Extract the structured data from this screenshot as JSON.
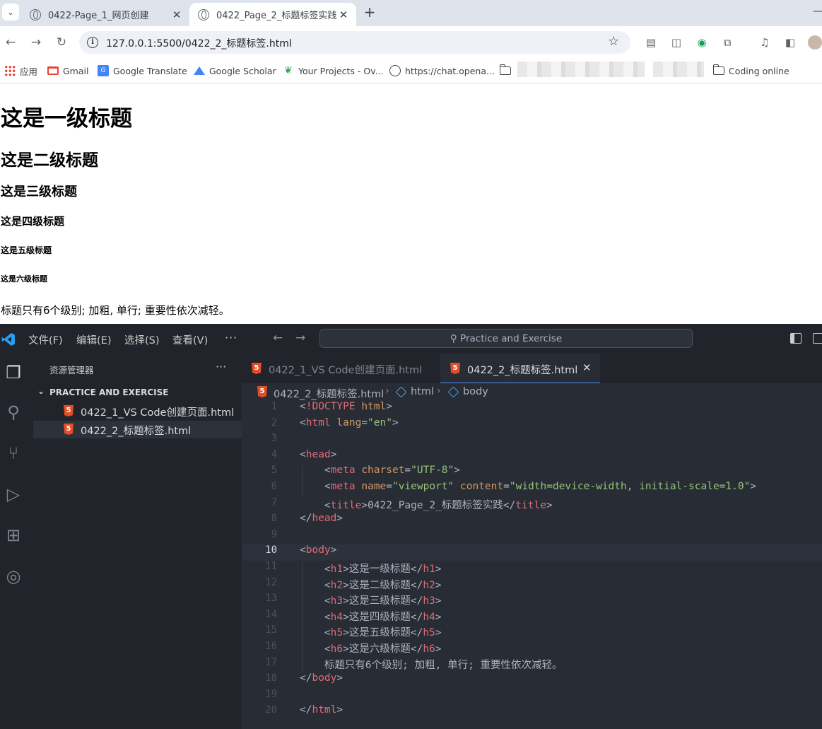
{
  "browser": {
    "tabs": [
      {
        "title": "0422-Page_1_网页创建",
        "active": false
      },
      {
        "title": "0422_Page_2_标题标签实践",
        "active": true
      }
    ],
    "new_tab_label": "+",
    "url": "127.0.0.1:5500/0422_2_标题标签.html",
    "bookmarks": [
      {
        "label": "应用",
        "icon": "apps-icon"
      },
      {
        "label": "Gmail",
        "icon": "gmail-icon"
      },
      {
        "label": "Google Translate",
        "icon": "google-translate-icon"
      },
      {
        "label": "Google Scholar",
        "icon": "google-scholar-icon"
      },
      {
        "label": "Your Projects - Ov...",
        "icon": "overleaf-icon"
      },
      {
        "label": "https://chat.opena...",
        "icon": "openai-icon"
      },
      {
        "label": "Coding online",
        "icon": "folder-icon"
      }
    ]
  },
  "page": {
    "h1": "这是一级标题",
    "h2": "这是二级标题",
    "h3": "这是三级标题",
    "h4": "这是四级标题",
    "h5": "这是五级标题",
    "h6": "这是六级标题",
    "paragraph": "标题只有6个级别; 加粗, 单行; 重要性依次减轻。"
  },
  "vscode": {
    "menu": [
      "文件(F)",
      "编辑(E)",
      "选择(S)",
      "查看(V)"
    ],
    "more": "···",
    "command_center": "Practice and Exercise",
    "explorer": {
      "title": "资源管理器",
      "more": "···",
      "folder": "PRACTICE AND EXERCISE",
      "files": [
        "0422_1_VS Code创建页面.html",
        "0422_2_标题标签.html"
      ]
    },
    "tabs": [
      {
        "label": "0422_1_VS Code创建页面.html",
        "active": false
      },
      {
        "label": "0422_2_标题标签.html",
        "active": true
      }
    ],
    "breadcrumb": [
      "0422_2_标题标签.html",
      "html",
      "body"
    ],
    "current_line": 10,
    "code": [
      {
        "n": "1",
        "t": [
          [
            "p",
            "<"
          ],
          [
            "t",
            "!DOCTYPE"
          ],
          [
            "p",
            " "
          ],
          [
            "a",
            "html"
          ],
          [
            "p",
            ">"
          ]
        ]
      },
      {
        "n": "2",
        "t": [
          [
            "p",
            "<"
          ],
          [
            "t",
            "html"
          ],
          [
            "p",
            " "
          ],
          [
            "a",
            "lang"
          ],
          [
            "p",
            "="
          ],
          [
            "s",
            "\"en\""
          ],
          [
            "p",
            ">"
          ]
        ]
      },
      {
        "n": "3",
        "t": []
      },
      {
        "n": "4",
        "t": [
          [
            "p",
            "<"
          ],
          [
            "t",
            "head"
          ],
          [
            "p",
            ">"
          ]
        ]
      },
      {
        "n": "5",
        "t": [
          [
            "p",
            "    <"
          ],
          [
            "t",
            "meta"
          ],
          [
            "p",
            " "
          ],
          [
            "a",
            "charset"
          ],
          [
            "p",
            "="
          ],
          [
            "s",
            "\"UTF-8\""
          ],
          [
            "p",
            ">"
          ]
        ]
      },
      {
        "n": "6",
        "t": [
          [
            "p",
            "    <"
          ],
          [
            "t",
            "meta"
          ],
          [
            "p",
            " "
          ],
          [
            "a",
            "name"
          ],
          [
            "p",
            "="
          ],
          [
            "s",
            "\"viewport\""
          ],
          [
            "p",
            " "
          ],
          [
            "a",
            "content"
          ],
          [
            "p",
            "="
          ],
          [
            "s",
            "\"width=device-width, initial-scale=1.0\""
          ],
          [
            "p",
            ">"
          ]
        ]
      },
      {
        "n": "7",
        "t": [
          [
            "p",
            "    <"
          ],
          [
            "t",
            "title"
          ],
          [
            "p",
            ">"
          ],
          [
            "x",
            "0422_Page_2_标题标签实践"
          ],
          [
            "p",
            "</"
          ],
          [
            "t",
            "title"
          ],
          [
            "p",
            ">"
          ]
        ]
      },
      {
        "n": "8",
        "t": [
          [
            "p",
            "</"
          ],
          [
            "t",
            "head"
          ],
          [
            "p",
            ">"
          ]
        ]
      },
      {
        "n": "9",
        "t": []
      },
      {
        "n": "10",
        "t": [
          [
            "p",
            "<"
          ],
          [
            "t",
            "body"
          ],
          [
            "p",
            ">"
          ]
        ]
      },
      {
        "n": "11",
        "t": [
          [
            "p",
            "    <"
          ],
          [
            "t",
            "h1"
          ],
          [
            "p",
            ">"
          ],
          [
            "x",
            "这是一级标题"
          ],
          [
            "p",
            "</"
          ],
          [
            "t",
            "h1"
          ],
          [
            "p",
            ">"
          ]
        ]
      },
      {
        "n": "12",
        "t": [
          [
            "p",
            "    <"
          ],
          [
            "t",
            "h2"
          ],
          [
            "p",
            ">"
          ],
          [
            "x",
            "这是二级标题"
          ],
          [
            "p",
            "</"
          ],
          [
            "t",
            "h2"
          ],
          [
            "p",
            ">"
          ]
        ]
      },
      {
        "n": "13",
        "t": [
          [
            "p",
            "    <"
          ],
          [
            "t",
            "h3"
          ],
          [
            "p",
            ">"
          ],
          [
            "x",
            "这是三级标题"
          ],
          [
            "p",
            "</"
          ],
          [
            "t",
            "h3"
          ],
          [
            "p",
            ">"
          ]
        ]
      },
      {
        "n": "14",
        "t": [
          [
            "p",
            "    <"
          ],
          [
            "t",
            "h4"
          ],
          [
            "p",
            ">"
          ],
          [
            "x",
            "这是四级标题"
          ],
          [
            "p",
            "</"
          ],
          [
            "t",
            "h4"
          ],
          [
            "p",
            ">"
          ]
        ]
      },
      {
        "n": "15",
        "t": [
          [
            "p",
            "    <"
          ],
          [
            "t",
            "h5"
          ],
          [
            "p",
            ">"
          ],
          [
            "x",
            "这是五级标题"
          ],
          [
            "p",
            "</"
          ],
          [
            "t",
            "h5"
          ],
          [
            "p",
            ">"
          ]
        ]
      },
      {
        "n": "16",
        "t": [
          [
            "p",
            "    <"
          ],
          [
            "t",
            "h6"
          ],
          [
            "p",
            ">"
          ],
          [
            "x",
            "这是六级标题"
          ],
          [
            "p",
            "</"
          ],
          [
            "t",
            "h6"
          ],
          [
            "p",
            ">"
          ]
        ]
      },
      {
        "n": "17",
        "t": [
          [
            "x",
            "    标题只有6个级别; 加粗, 单行; 重要性依次减轻。"
          ]
        ]
      },
      {
        "n": "18",
        "t": [
          [
            "p",
            "</"
          ],
          [
            "t",
            "body"
          ],
          [
            "p",
            ">"
          ]
        ]
      },
      {
        "n": "19",
        "t": []
      },
      {
        "n": "20",
        "t": [
          [
            "p",
            "</"
          ],
          [
            "t",
            "html"
          ],
          [
            "p",
            ">"
          ]
        ]
      }
    ]
  },
  "colors": {
    "tag": "#e06c75",
    "attribute": "#d19a66",
    "string": "#98c379",
    "text": "#abb2bf",
    "html5_icon": "#e44d26",
    "editor_bg": "#282c34"
  }
}
